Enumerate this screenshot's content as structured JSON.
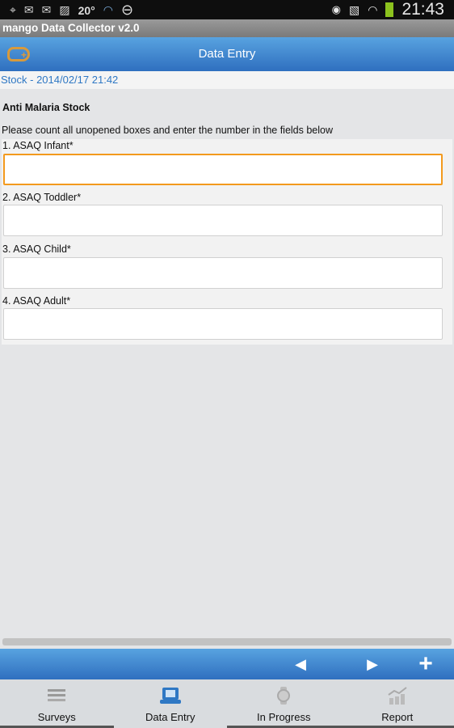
{
  "status_bar": {
    "temperature": "20°",
    "time": "21:43",
    "icons": [
      "gps-icon",
      "email-icon",
      "email-icon",
      "image-icon",
      "wifi-icon",
      "do-not-disturb-icon",
      "eye-icon",
      "mute-icon",
      "wifi-icon",
      "battery-icon"
    ]
  },
  "app_title": "mango Data Collector v2.0",
  "header": {
    "title": "Data Entry"
  },
  "breadcrumb": "Stock - 2014/02/17 21:42",
  "form": {
    "section_title": "Anti Malaria Stock",
    "instructions": "Please count all unopened boxes and enter the number in the fields below",
    "fields": [
      {
        "label": "1. ASAQ Infant*",
        "value": ""
      },
      {
        "label": "2. ASAQ Toddler*",
        "value": ""
      },
      {
        "label": "3. ASAQ Child*",
        "value": ""
      },
      {
        "label": "4. ASAQ Adult*",
        "value": ""
      }
    ]
  },
  "toolbar": {
    "prev": "◀",
    "next": "▶",
    "add": "+"
  },
  "tabs": [
    {
      "label": "Surveys"
    },
    {
      "label": "Data Entry",
      "selected": true
    },
    {
      "label": "In Progress"
    },
    {
      "label": "Report"
    }
  ],
  "colors": {
    "accent": "#3b82cf",
    "focus": "#f39a1d",
    "brand": "#d89a3c"
  }
}
